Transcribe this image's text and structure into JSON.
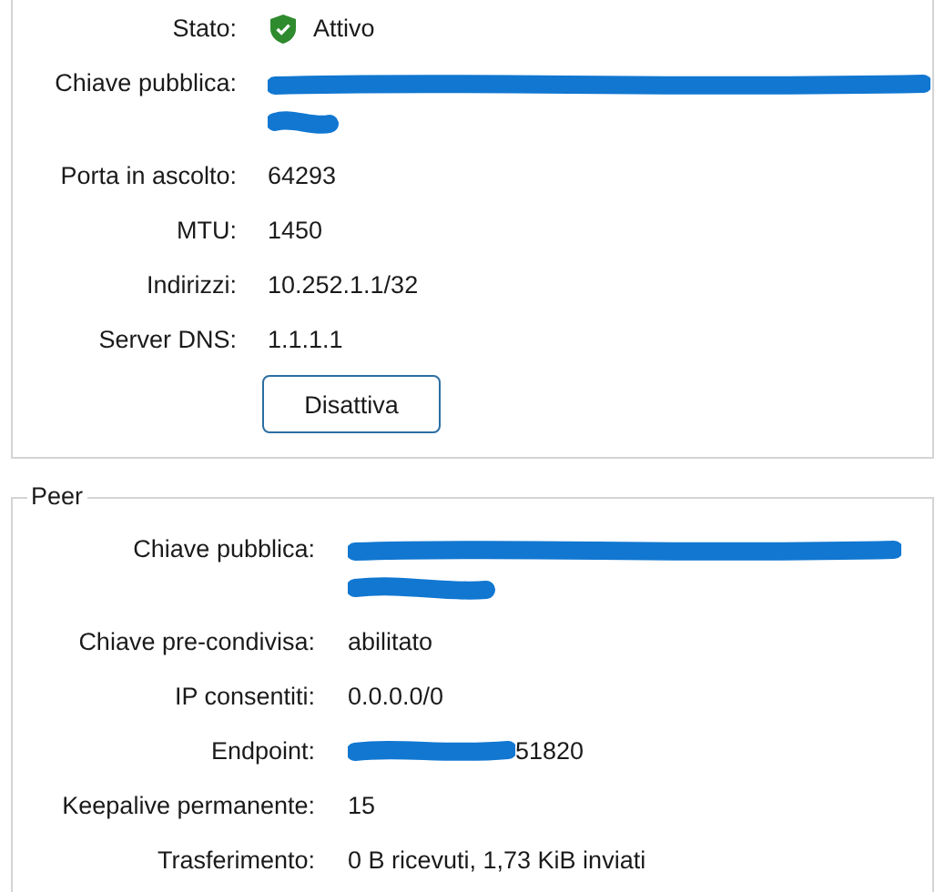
{
  "interface": {
    "rows": [
      {
        "label": "Stato:",
        "kind": "status",
        "value": "Attivo"
      },
      {
        "label": "Chiave pubblica:",
        "kind": "redacted"
      },
      {
        "label": "Porta in ascolto:",
        "kind": "text",
        "value": "64293"
      },
      {
        "label": "MTU:",
        "kind": "text",
        "value": "1450"
      },
      {
        "label": "Indirizzi:",
        "kind": "text",
        "value": "10.252.1.1/32"
      },
      {
        "label": "Server DNS:",
        "kind": "text",
        "value": "1.1.1.1"
      }
    ],
    "button": "Disattiva"
  },
  "peer": {
    "title": "Peer",
    "rows": [
      {
        "label": "Chiave pubblica:",
        "kind": "redacted"
      },
      {
        "label": "Chiave pre-condivisa:",
        "kind": "text",
        "value": "abilitato"
      },
      {
        "label": "IP consentiti:",
        "kind": "text",
        "value": "0.0.0.0/0"
      },
      {
        "label": "Endpoint:",
        "kind": "partly_redacted",
        "value": "51820"
      },
      {
        "label": "Keepalive permanente:",
        "kind": "text",
        "value": "15"
      },
      {
        "label": "Trasferimento:",
        "kind": "text",
        "value": "0 B ricevuti, 1,73 KiB inviati"
      }
    ]
  }
}
